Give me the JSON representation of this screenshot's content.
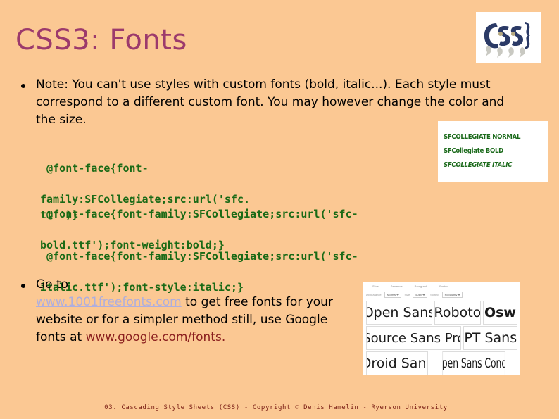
{
  "slide": {
    "title": "CSS3: Fonts",
    "background_color": "#fbc893",
    "title_color": "#9c3a6c",
    "code_color": "#1a6a16",
    "link_color": "#aeaede",
    "red_link_color": "#8a1e1e"
  },
  "logo": {
    "name": "css-logo",
    "text": "C·S·S}"
  },
  "bullets": [
    {
      "id": "note",
      "text_line_1": "Note: You can't use styles with custom fonts (bold, italic...).",
      "text_line_2": "Each style must correspond to a different custom font. You",
      "text_line_3": "may however change the color and the size."
    },
    {
      "id": "goto",
      "lead": "Go to ",
      "link_label": "www.1001freefonts.com",
      "after_link": " to get free fonts for your website or for a simpler method still, use Google fonts at ",
      "red_link_label": "www.google.com/fonts."
    }
  ],
  "code_blocks": [
    {
      "id": "code-1",
      "line_1": "@font-face{font-",
      "line_2": "family:SFCollegiate;src:url('sfc.ttf')}"
    },
    {
      "id": "code-2",
      "line_1": "@font-face{font-family:SFCollegiate;src:url('sfc-",
      "line_2": "bold.ttf');font-weight:bold;}"
    },
    {
      "id": "code-3",
      "line_1": "@font-face{font-family:SFCollegiate;src:url('sfc-",
      "line_2": "italic.ttf');font-style:italic;}"
    }
  ],
  "sfc_sample_image": {
    "name": "sfcollegiate-sample-image",
    "lines": [
      "SFCOLLEGIATE NORMAL",
      "SFCollegiate BOLD",
      "SFCOLLEGIATE ITALIC"
    ],
    "text_color": "#1b6a1b"
  },
  "google_fonts_image": {
    "name": "google-fonts-screenshot",
    "tabs": [
      "Slice",
      "Sentence",
      "Paragraph",
      "Poster"
    ],
    "filters": {
      "label": "Appearance",
      "select_1": "Normal",
      "size_label": "Size",
      "select_2": "50px",
      "sort_label": "Sorting",
      "select_3": "Popularity"
    },
    "font_cards": [
      [
        "Open Sans",
        "Roboto",
        "Osw"
      ],
      [
        "Source Sans Pro",
        "PT Sans"
      ],
      [
        "Droid Sans",
        "Open Sans Conde"
      ]
    ]
  },
  "footer": {
    "text": "03. Cascading Style Sheets (CSS) - Copyright © Denis Hamelin - Ryerson University"
  }
}
